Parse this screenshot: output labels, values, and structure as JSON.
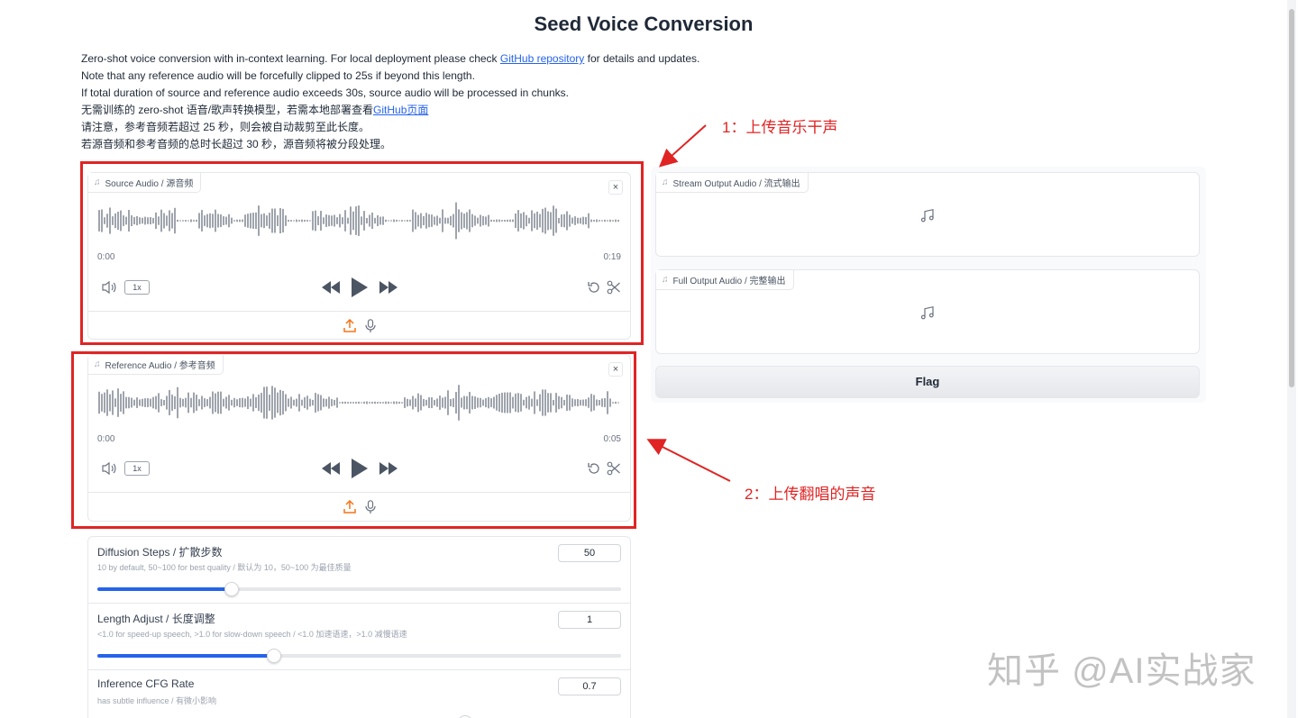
{
  "title": "Seed Voice Conversion",
  "description": {
    "line1_prefix": "Zero-shot voice conversion with in-context learning. For local deployment please check ",
    "line1_link": "GitHub repository",
    "line1_suffix": " for details and updates.",
    "line2": "Note that any reference audio will be forcefully clipped to 25s if beyond this length.",
    "line3": "If total duration of source and reference audio exceeds 30s, source audio will be processed in chunks.",
    "line4_prefix": "无需训练的 zero-shot 语音/歌声转换模型，若需本地部署查看",
    "line4_link": "GitHub页面",
    "line5": "请注意，参考音频若超过 25 秒，则会被自动裁剪至此长度。",
    "line6": "若源音频和参考音频的总时长超过 30 秒，源音频将被分段处理。"
  },
  "source_audio": {
    "label": "Source Audio / 源音频",
    "time_start": "0:00",
    "time_end": "0:19",
    "speed": "1x"
  },
  "reference_audio": {
    "label": "Reference Audio / 参考音频",
    "time_start": "0:00",
    "time_end": "0:05",
    "speed": "1x"
  },
  "stream_output": {
    "label": "Stream Output Audio / 流式输出"
  },
  "full_output": {
    "label": "Full Output Audio / 完整输出"
  },
  "flag_button": "Flag",
  "annotations": {
    "a1": "1：上传音乐干声",
    "a2": "2：上传翻唱的声音"
  },
  "sliders": [
    {
      "label": "Diffusion Steps / 扩散步数",
      "info": "10 by default, 50~100 for best quality / 默认为 10，50~100 为最佳质量",
      "value": "50",
      "fraction": 0.255
    },
    {
      "label": "Length Adjust / 长度调整",
      "info": "<1.0 for speed-up speech, >1.0 for slow-down speech / <1.0 加速语速，>1.0 减慢语速",
      "value": "1",
      "fraction": 0.337
    },
    {
      "label": "Inference CFG Rate",
      "info": "has subtle influence / 有微小影响",
      "value": "0.7",
      "fraction": 0.7
    }
  ],
  "watermark": "知乎 @AI实战家",
  "colors": {
    "accent": "#2563eb",
    "annotation": "#e02424",
    "upload_icon": "#f97316"
  }
}
